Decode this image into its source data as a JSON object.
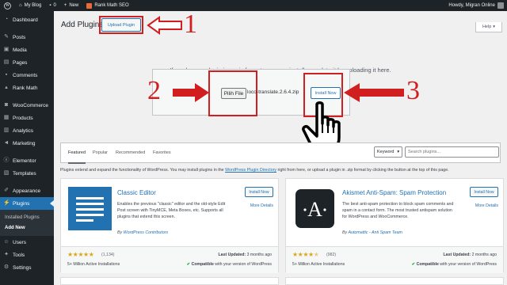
{
  "adminbar": {
    "site_name": "My Blog",
    "comments_count": "0",
    "new_label": "New",
    "rank_math_label": "Rank Math SEO",
    "greeting": "Howdy, Migran Online"
  },
  "sidebar": {
    "items": [
      {
        "label": "Dashboard",
        "icon": "dashboard-icon"
      },
      {
        "label": "Posts",
        "icon": "pin-icon"
      },
      {
        "label": "Media",
        "icon": "media-icon"
      },
      {
        "label": "Pages",
        "icon": "page-icon"
      },
      {
        "label": "Comments",
        "icon": "comment-icon"
      },
      {
        "label": "Rank Math",
        "icon": "rank-math-icon"
      },
      {
        "label": "WooCommerce",
        "icon": "woocommerce-icon"
      },
      {
        "label": "Products",
        "icon": "products-icon"
      },
      {
        "label": "Analytics",
        "icon": "analytics-icon"
      },
      {
        "label": "Marketing",
        "icon": "megaphone-icon"
      },
      {
        "label": "Elementor",
        "icon": "elementor-icon"
      },
      {
        "label": "Templates",
        "icon": "templates-icon"
      },
      {
        "label": "Appearance",
        "icon": "brush-icon"
      },
      {
        "label": "Plugins",
        "icon": "plugin-icon"
      },
      {
        "label": "Users",
        "icon": "user-icon"
      },
      {
        "label": "Tools",
        "icon": "wrench-icon"
      },
      {
        "label": "Settings",
        "icon": "settings-icon"
      }
    ],
    "submenu": [
      "Installed Plugins",
      "Add New"
    ]
  },
  "page": {
    "title": "Add Plugins",
    "upload_button": "Upload Plugin",
    "help": "Help",
    "upload_text": "If you have a plugin in a .zip format, you may install or update it by uploading it here.",
    "file_button": "Pilih File",
    "file_name": "loco-translate.2.6.4.zip",
    "install_now": "Install Now"
  },
  "annotations": [
    "1",
    "2",
    "3"
  ],
  "filters": {
    "tabs": [
      "Featured",
      "Popular",
      "Recommended",
      "Favorites"
    ],
    "search_type": "Keyword",
    "search_placeholder": "Search plugins..."
  },
  "description": {
    "before": "Plugins extend and expand the functionality of WordPress. You may install plugins in the ",
    "link": "WordPress Plugin Directory",
    "after": " right from here, or upload a plugin in .zip format by clicking the button at the top of this page."
  },
  "plugins": [
    {
      "name": "Classic Editor",
      "description": "Enables the previous \"classic\" editor and the old-style Edit Post screen with TinyMCE, Meta Boxes, etc. Supports all plugins that extend this screen.",
      "author_prefix": "By ",
      "author": "WordPress Contributors",
      "install": "Install Now",
      "more": "More Details",
      "rating_count": "(1,134)",
      "installs": "5+ Million Active Installations",
      "updated_label": "Last Updated:",
      "updated": "3 months ago",
      "compat_strong": "Compatible",
      "compat_rest": "with your version of WordPress",
      "rating": 5
    },
    {
      "name": "Akismet Anti-Spam: Spam Protection",
      "description": "The best anti-spam protection to block spam comments and spam in a contact form. The most trusted antispam solution for WordPress and WooCommerce.",
      "author_prefix": "By ",
      "author": "Automattic - Anti Spam Team",
      "install": "Install Now",
      "more": "More Details",
      "rating_count": "(982)",
      "installs": "5+ Million Active Installations",
      "updated_label": "Last Updated:",
      "updated": "2 months ago",
      "compat_strong": "Compatible",
      "compat_rest": "with your version of WordPress",
      "rating": 4.5
    }
  ],
  "colors": {
    "accent": "#2271b1",
    "annotation_red": "#d11f1f",
    "admin_dark": "#1d2327",
    "star": "#dba617"
  }
}
